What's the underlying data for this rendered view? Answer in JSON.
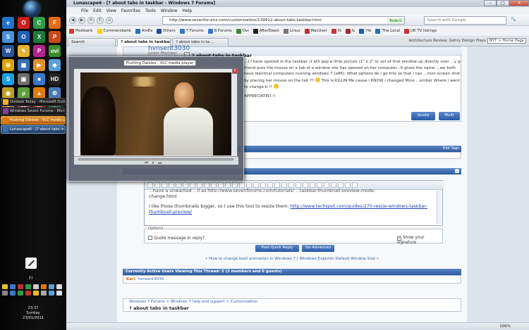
{
  "taskbar": {
    "pinned": [
      {
        "icon": "ie-icon",
        "glyph": "e",
        "color": "#1f73c8"
      },
      {
        "icon": "opera-icon",
        "glyph": "O",
        "color": "#cc1f1f"
      },
      {
        "icon": "chrome-icon",
        "glyph": "C",
        "color": "#2e9e4a"
      },
      {
        "icon": "firefox-icon",
        "glyph": "F",
        "color": "#e46b14"
      },
      {
        "icon": "safari-icon",
        "glyph": "S",
        "color": "#4a90d9"
      },
      {
        "icon": "outlook-icon",
        "glyph": "O",
        "color": "#1f5fb0"
      },
      {
        "icon": "excel-icon",
        "glyph": "X",
        "color": "#1d7a3b"
      },
      {
        "icon": "powerpoint-icon",
        "glyph": "P",
        "color": "#c84a1c"
      },
      {
        "icon": "word-icon",
        "glyph": "W",
        "color": "#2b579a"
      },
      {
        "icon": "paint-icon",
        "glyph": "✎",
        "color": "#e8b12c"
      },
      {
        "icon": "photos-icon",
        "glyph": "P",
        "color": "#b6238f"
      },
      {
        "icon": "ovi-icon",
        "glyph": "ovi",
        "color": "#3c8b2c"
      },
      {
        "icon": "windows-icon",
        "glyph": "⊞",
        "color": "#d9a300"
      },
      {
        "icon": "dashboard-icon",
        "glyph": "▦",
        "color": "#3a6fb0"
      },
      {
        "icon": "media-icon",
        "glyph": "▶",
        "color": "#e0902a"
      },
      {
        "icon": "gadget-icon",
        "glyph": "◆",
        "color": "#5aa0d8"
      },
      {
        "icon": "skype-icon",
        "glyph": "S",
        "color": "#1aa0e0"
      },
      {
        "icon": "vmware-icon",
        "glyph": "▣",
        "color": "#6e6e6e"
      },
      {
        "icon": "cube-icon",
        "glyph": "■",
        "color": "#3a78c8"
      },
      {
        "icon": "hd-icon",
        "glyph": "HD",
        "color": "#222222"
      },
      {
        "icon": "winamp-icon",
        "glyph": "◉",
        "color": "#c0a020"
      },
      {
        "icon": "utorrent-icon",
        "glyph": "µ",
        "color": "#5aa03c"
      },
      {
        "icon": "vlc-icon",
        "glyph": "▲",
        "color": "#e07a0a"
      },
      {
        "icon": "settings-icon",
        "glyph": "⚙",
        "color": "#4a7ab8"
      },
      {
        "icon": "media-player-icon",
        "glyph": "●",
        "color": "#d48a1e"
      },
      {
        "icon": "flower-icon",
        "glyph": "✿",
        "color": "#c23a6e"
      },
      {
        "icon": "tv-icon",
        "glyph": "tv",
        "color": "#cc2222"
      },
      {
        "icon": "ovi-suite-icon",
        "glyph": "▲",
        "color": "#2a7a3a"
      }
    ],
    "tasks": [
      {
        "label": "Outlook Today - Microsoft Outl...",
        "color": "#f0b020",
        "state": "normal"
      },
      {
        "label": "Windows Seven Forums - Micr...",
        "color": "#8a3aa8",
        "state": "normal"
      },
      {
        "label": "Pushing Daisies - VLC media pl...",
        "color": "#e07a0a",
        "state": "hot"
      },
      {
        "label": "Lunascape6 - [? about tabs in ...",
        "color": "#3a6fb0",
        "state": "active"
      }
    ],
    "lang": "FI",
    "clock": {
      "time": "23:37",
      "day": "Sunday",
      "date": "23/01/2011"
    }
  },
  "browser": {
    "title": "Lunascape6 - [? about tabs in taskbar - Windows 7 Forums]",
    "menu": [
      "File",
      "Edit",
      "View",
      "Favorites",
      "Tools",
      "Window",
      "Help"
    ],
    "url": "http://www.sevenforums.com/customization/139912-about-tabs-taskbar.html",
    "identity": "Tedent",
    "search_placeholder": "Search with Google",
    "bookmarks": [
      "Postbank",
      "Commerzbank",
      "AmEx",
      "Diners",
      "7 Forums",
      "8 Forums",
      "Ovi",
      "AfterDawn",
      "Linux",
      "MacUser",
      "IS",
      "IL",
      "Yle",
      "The Local",
      "UK TV listings"
    ],
    "sidebar_search": "Search",
    "tabs": [
      {
        "label": "? about tabs in taskbar",
        "active": true
      },
      {
        "label": "? about tabs in ta...",
        "active": false
      }
    ],
    "tab_right": {
      "text": "Architecture Review: Gehry Design Plays",
      "nyt": "NYT > Home Page"
    },
    "zoom": "106%"
  },
  "preview": {
    "tooltip": "Pushing Daisies - VLC media player"
  },
  "post": {
    "user": "hvnsent3030",
    "role": "Junior Member",
    "title": "? about tabs in taskbar",
    "p1": "...t I have opened in the taskbar..it will pop a little picture (1\" x 2\" or so) of that window up directly over ...y g-friend puts the mouse on a tab of a window she has opened on her computer...it gives the name ...we both have identical computers running windows 7 (x86). What options do i go into so that i can ...mini screen shot by placing her mouse on the tab ??",
    "p1b": "This is KILLIN Me cause i KNOW i changed Mine ...ember Where i went to change it !!",
    "p2": "APPRECIATED !!",
    "quote": "Quote",
    "multi": "Multi"
  },
  "tags": {
    "edit": "Edit Tags"
  },
  "reply": {
    "cut": "...have a unwanted ...ll as http://www.sevenforums.com/tutorials/ ...taskbar-thumbnail-preview-mode-",
    "l1": "change.html",
    "l2": "I like those thumbnails bigger, so I use this tool to resize them: ",
    "link": "http://www.techspot.com/guides/270-resize-windows-taskbar-thumbnail-preview/",
    "options": "Options",
    "quote_msg": "Quote message in reply?",
    "show_sig": "Show your signature",
    "post_btn": "Post Quick Reply",
    "adv_btn": "Go Advanced"
  },
  "threadnav": {
    "prev": "How to change boot animation in Windows 7",
    "sep": " | ",
    "next": "Windows Explorer Default Window Size"
  },
  "active": {
    "header": "Currently Active Users Viewing This Thread: 2 (2 members and 0 guests)",
    "u1": "Kari",
    "u2": "hvnsent3030"
  },
  "crumbs": {
    "path": "Windows 7 Forums > Windows 7 help and support > Customization",
    "current": "? about tabs in taskbar"
  }
}
